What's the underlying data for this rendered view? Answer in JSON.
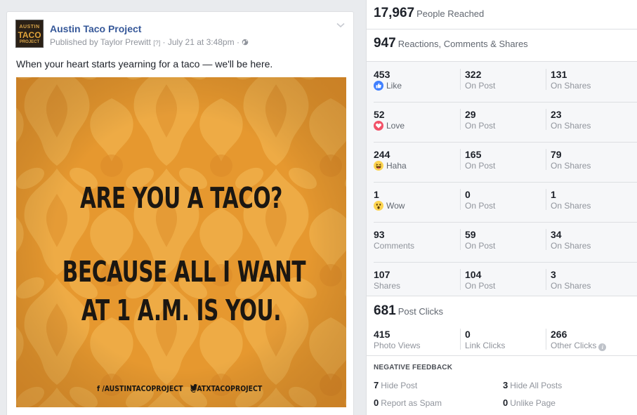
{
  "post": {
    "page_name": "Austin Taco Project",
    "meta": "Published by Taylor Prewitt",
    "meta_q": "[?]",
    "meta_date": " · July 21 at 3:48pm · ",
    "text": "When your heart starts yearning for a taco — we'll be here.",
    "avatar": {
      "line1": "AUSTIN",
      "line2": "TACO",
      "line3": "PROJECT"
    },
    "image": {
      "line1": "ARE YOU A TACO?",
      "line2": "BECAUSE ALL I WANT",
      "line3": "AT 1 A.M. IS YOU.",
      "facebook": "f /AUSTINTACOPROJECT",
      "twitter": "@ATXTACOPROJECT",
      "bg_color": "#e6982f"
    }
  },
  "insights": {
    "reached": {
      "value": "17,967",
      "label": "People Reached"
    },
    "reactions": {
      "value": "947",
      "label": "Reactions, Comments & Shares"
    },
    "rows": [
      {
        "total": "453",
        "label": "Like",
        "icon": "like-icon",
        "on_post": "322",
        "on_shares": "131"
      },
      {
        "total": "52",
        "label": "Love",
        "icon": "love-icon",
        "on_post": "29",
        "on_shares": "23"
      },
      {
        "total": "244",
        "label": "Haha",
        "icon": "haha-icon",
        "on_post": "165",
        "on_shares": "79"
      },
      {
        "total": "1",
        "label": "Wow",
        "icon": "wow-icon",
        "on_post": "0",
        "on_shares": "1"
      },
      {
        "total": "93",
        "label": "Comments",
        "icon": "",
        "on_post": "59",
        "on_shares": "34"
      },
      {
        "total": "107",
        "label": "Shares",
        "icon": "",
        "on_post": "104",
        "on_shares": "3"
      }
    ],
    "on_post_label": "On Post",
    "on_shares_label": "On Shares",
    "clicks": {
      "value": "681",
      "label": "Post Clicks",
      "photo_views": "415",
      "photo_views_label": "Photo Views",
      "link_clicks": "0",
      "link_clicks_label": "Link Clicks",
      "other_clicks": "266",
      "other_clicks_label": "Other Clicks"
    },
    "negative": {
      "title": "NEGATIVE FEEDBACK",
      "hide_post": "7",
      "hide_post_label": "Hide Post",
      "hide_all": "3",
      "hide_all_label": "Hide All Posts",
      "report_spam": "0",
      "report_spam_label": "Report as Spam",
      "unlike_page": "0",
      "unlike_page_label": "Unlike Page"
    },
    "colors": {
      "link": "#365899",
      "like": "#4080ff",
      "love": "#f25268",
      "haha": "#fcd450"
    }
  }
}
